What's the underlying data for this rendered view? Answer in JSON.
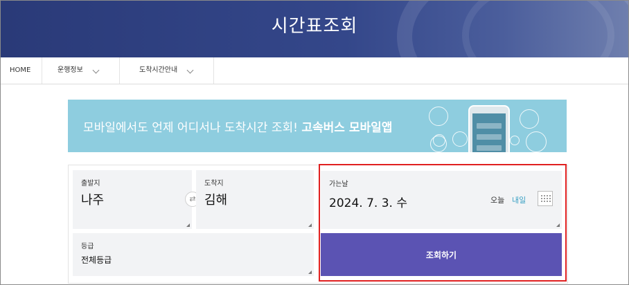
{
  "hero": {
    "title": "시간표조회"
  },
  "breadcrumb": [
    {
      "label": "HOME"
    },
    {
      "label": "운행정보"
    },
    {
      "label": "도착시간안내"
    }
  ],
  "promo": {
    "text": "모바일에서도 언제 어디서나 도착시간 조회!",
    "highlight": "고속버스 모바일앱"
  },
  "form": {
    "departure": {
      "label": "출발지",
      "value": "나주"
    },
    "arrival": {
      "label": "도착지",
      "value": "김해"
    },
    "date": {
      "label": "가는날",
      "value": "2024. 7. 3. 수",
      "today": "오늘",
      "tomorrow": "내일"
    },
    "grade": {
      "label": "등급",
      "value": "전체등급"
    },
    "submit_label": "조회하기"
  },
  "colors": {
    "hero": "#2a3a78",
    "promo": "#8ecddf",
    "submit": "#5b53b3",
    "link": "#3aa1c4",
    "highlight": "#e02020"
  }
}
